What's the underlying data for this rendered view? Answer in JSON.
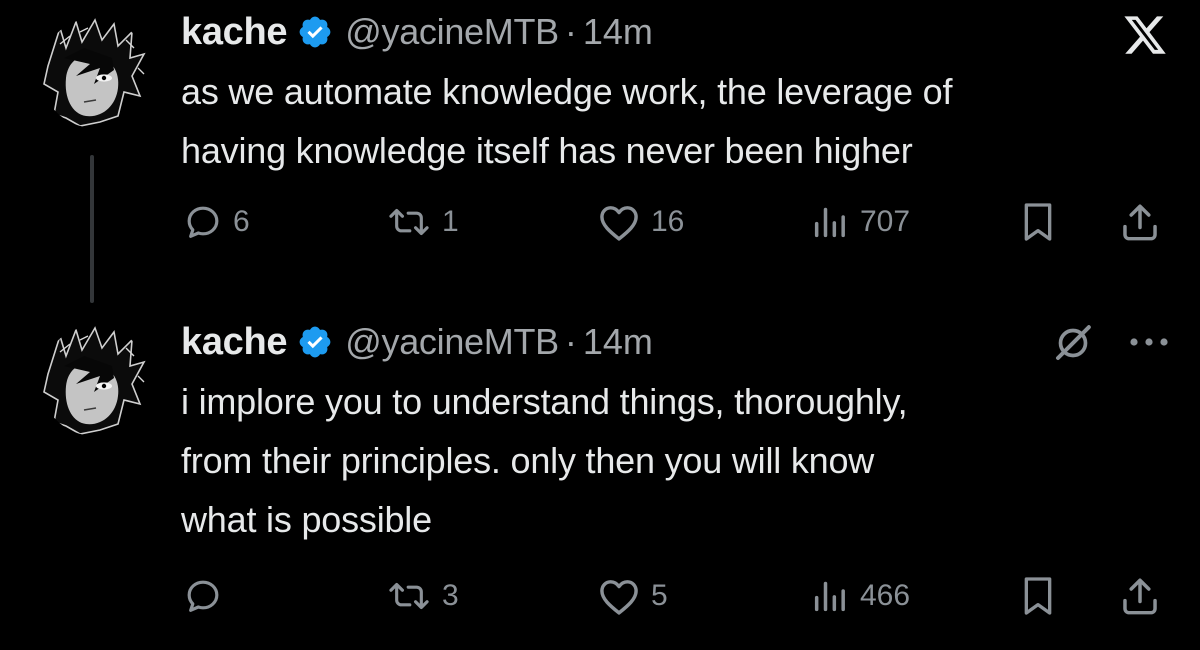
{
  "tweets": [
    {
      "author": {
        "display_name": "kache",
        "handle": "@yacineMTB",
        "verified": true
      },
      "separator": "·",
      "time": "14m",
      "text": "as we automate knowledge work, the leverage of\nhaving knowledge itself has never been higher",
      "actions": {
        "replies": "6",
        "reposts": "1",
        "likes": "16",
        "views": "707"
      }
    },
    {
      "author": {
        "display_name": "kache",
        "handle": "@yacineMTB",
        "verified": true
      },
      "separator": "·",
      "time": "14m",
      "text": "i implore you to understand things, thoroughly,\nfrom their principles. only then you will know\nwhat is possible",
      "actions": {
        "replies": "",
        "reposts": "3",
        "likes": "5",
        "views": "466"
      }
    }
  ],
  "icons": {
    "brand": "x-logo-icon",
    "verified": "verified-badge-icon",
    "reply": "reply-icon",
    "repost": "repost-icon",
    "like": "heart-icon",
    "views": "views-icon",
    "bookmark": "bookmark-icon",
    "share": "share-icon",
    "grok": "grok-icon",
    "more": "more-icon"
  },
  "colors": {
    "background": "#000000",
    "text": "#e7e9ea",
    "secondary_text": "#a3a7ab",
    "action_icon": "#8b9197",
    "verified_blue": "#1d9bf0",
    "thread_line": "#333639"
  }
}
